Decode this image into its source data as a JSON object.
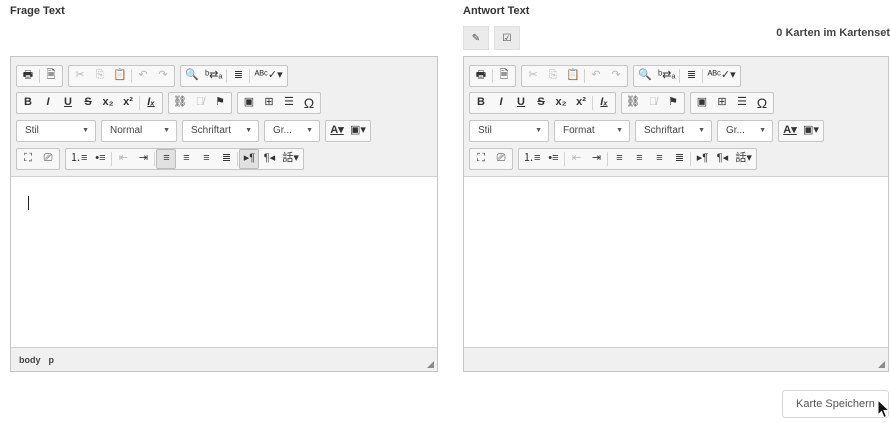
{
  "labels": {
    "question": "Frage Text",
    "answer": "Antwort Text"
  },
  "cards_count": "0 Karten im Kartenset",
  "mode_buttons": [
    {
      "icon": "pencil-icon",
      "glyph": "✎"
    },
    {
      "icon": "checkbox-icon",
      "glyph": "☑"
    }
  ],
  "toolbar": {
    "print": "🖶",
    "template": "🗎",
    "cut": "✂",
    "copy": "⎘",
    "paste": "📋",
    "undo": "↶",
    "redo": "↷",
    "find": "🔍",
    "replace": "ᵇ⇄ₐ",
    "show_blocks": "≣",
    "spellcheck": "ᴬᴮᶜ✓▾",
    "bold": "B",
    "italic": "I",
    "underline": "U",
    "strike": "S",
    "subscript": "x₂",
    "superscript": "x²",
    "remove_format": "Iₓ",
    "link": "⛓",
    "unlink": "⛓̸",
    "anchor": "⚑",
    "image": "▣",
    "table": "⊞",
    "hrule": "☰",
    "special_char": "Ω",
    "maximize": "⛶",
    "source": "⎚",
    "numlist": "⒈≡",
    "bulletlist": "•≡",
    "outdent": "⇤",
    "indent": "⇥",
    "align_left": "≡",
    "align_center": "≡",
    "align_right": "≡",
    "justify": "≣",
    "ltr": "▸¶",
    "rtl": "¶◂",
    "language": "話▾",
    "text_color": "A▾",
    "bg_color": "▣▾"
  },
  "editors": {
    "question": {
      "style": "Stil",
      "format": "Normal",
      "font": "Schriftart",
      "size": "Gr...",
      "path": [
        "body",
        "p"
      ]
    },
    "answer": {
      "style": "Stil",
      "format": "Format",
      "font": "Schriftart",
      "size": "Gr..."
    }
  },
  "save_button": "Karte Speichern"
}
